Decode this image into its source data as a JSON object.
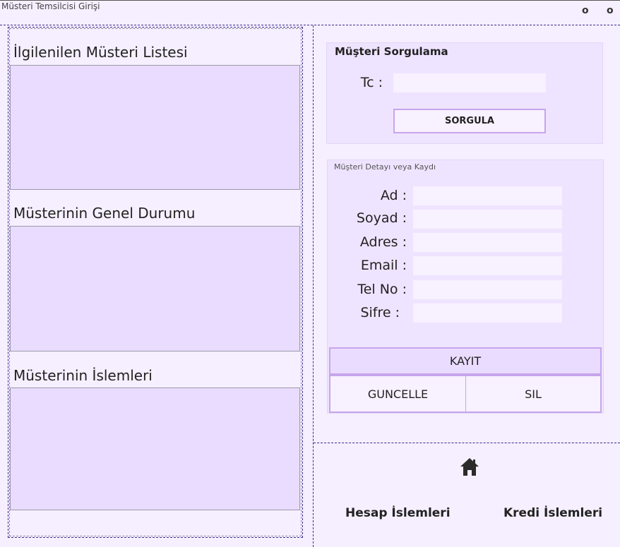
{
  "window": {
    "title": "Müsteri Temsilcisi Girişi",
    "btn1": "o",
    "btn2": "o"
  },
  "left": {
    "section1": "İlgilenilen Müsteri Listesi",
    "section2": "Müsterinin Genel Durumu",
    "section3": "Müsterinin İslemleri"
  },
  "query": {
    "title": "Müşteri Sorgulama",
    "tc_label": "Tc :",
    "tc_value": "",
    "button": "SORGULA"
  },
  "detail": {
    "title": "Müşteri Detayı veya Kaydı",
    "fields": [
      {
        "label": "Ad :",
        "value": ""
      },
      {
        "label": "Soyad :",
        "value": ""
      },
      {
        "label": "Adres :",
        "value": ""
      },
      {
        "label": "Email :",
        "value": ""
      },
      {
        "label": "Tel No :",
        "value": ""
      },
      {
        "label": "Sifre :",
        "value": ""
      }
    ],
    "save": "KAYIT",
    "update": "GUNCELLE",
    "delete": "SIL"
  },
  "nav": {
    "home_icon": "home-icon",
    "account": "Hesap İslemleri",
    "credit": "Kredi İslemleri"
  }
}
